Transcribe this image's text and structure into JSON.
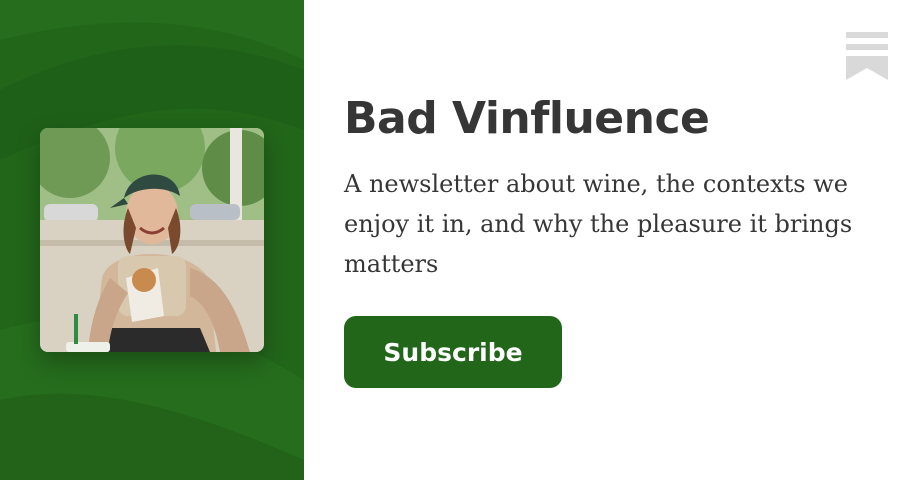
{
  "publication": {
    "title": "Bad Vinfluence",
    "description": "A newsletter about wine, the contexts we enjoy it in, and why the pleasure it brings matters",
    "subscribe_label": "Subscribe"
  },
  "icons": {
    "avatar": "publication-avatar-photo",
    "brand": "bookmark-stack-icon"
  },
  "colors": {
    "accent": "#22661a",
    "text": "#363636",
    "background": "#ffffff",
    "brand_mark": "#d9d9d9"
  }
}
